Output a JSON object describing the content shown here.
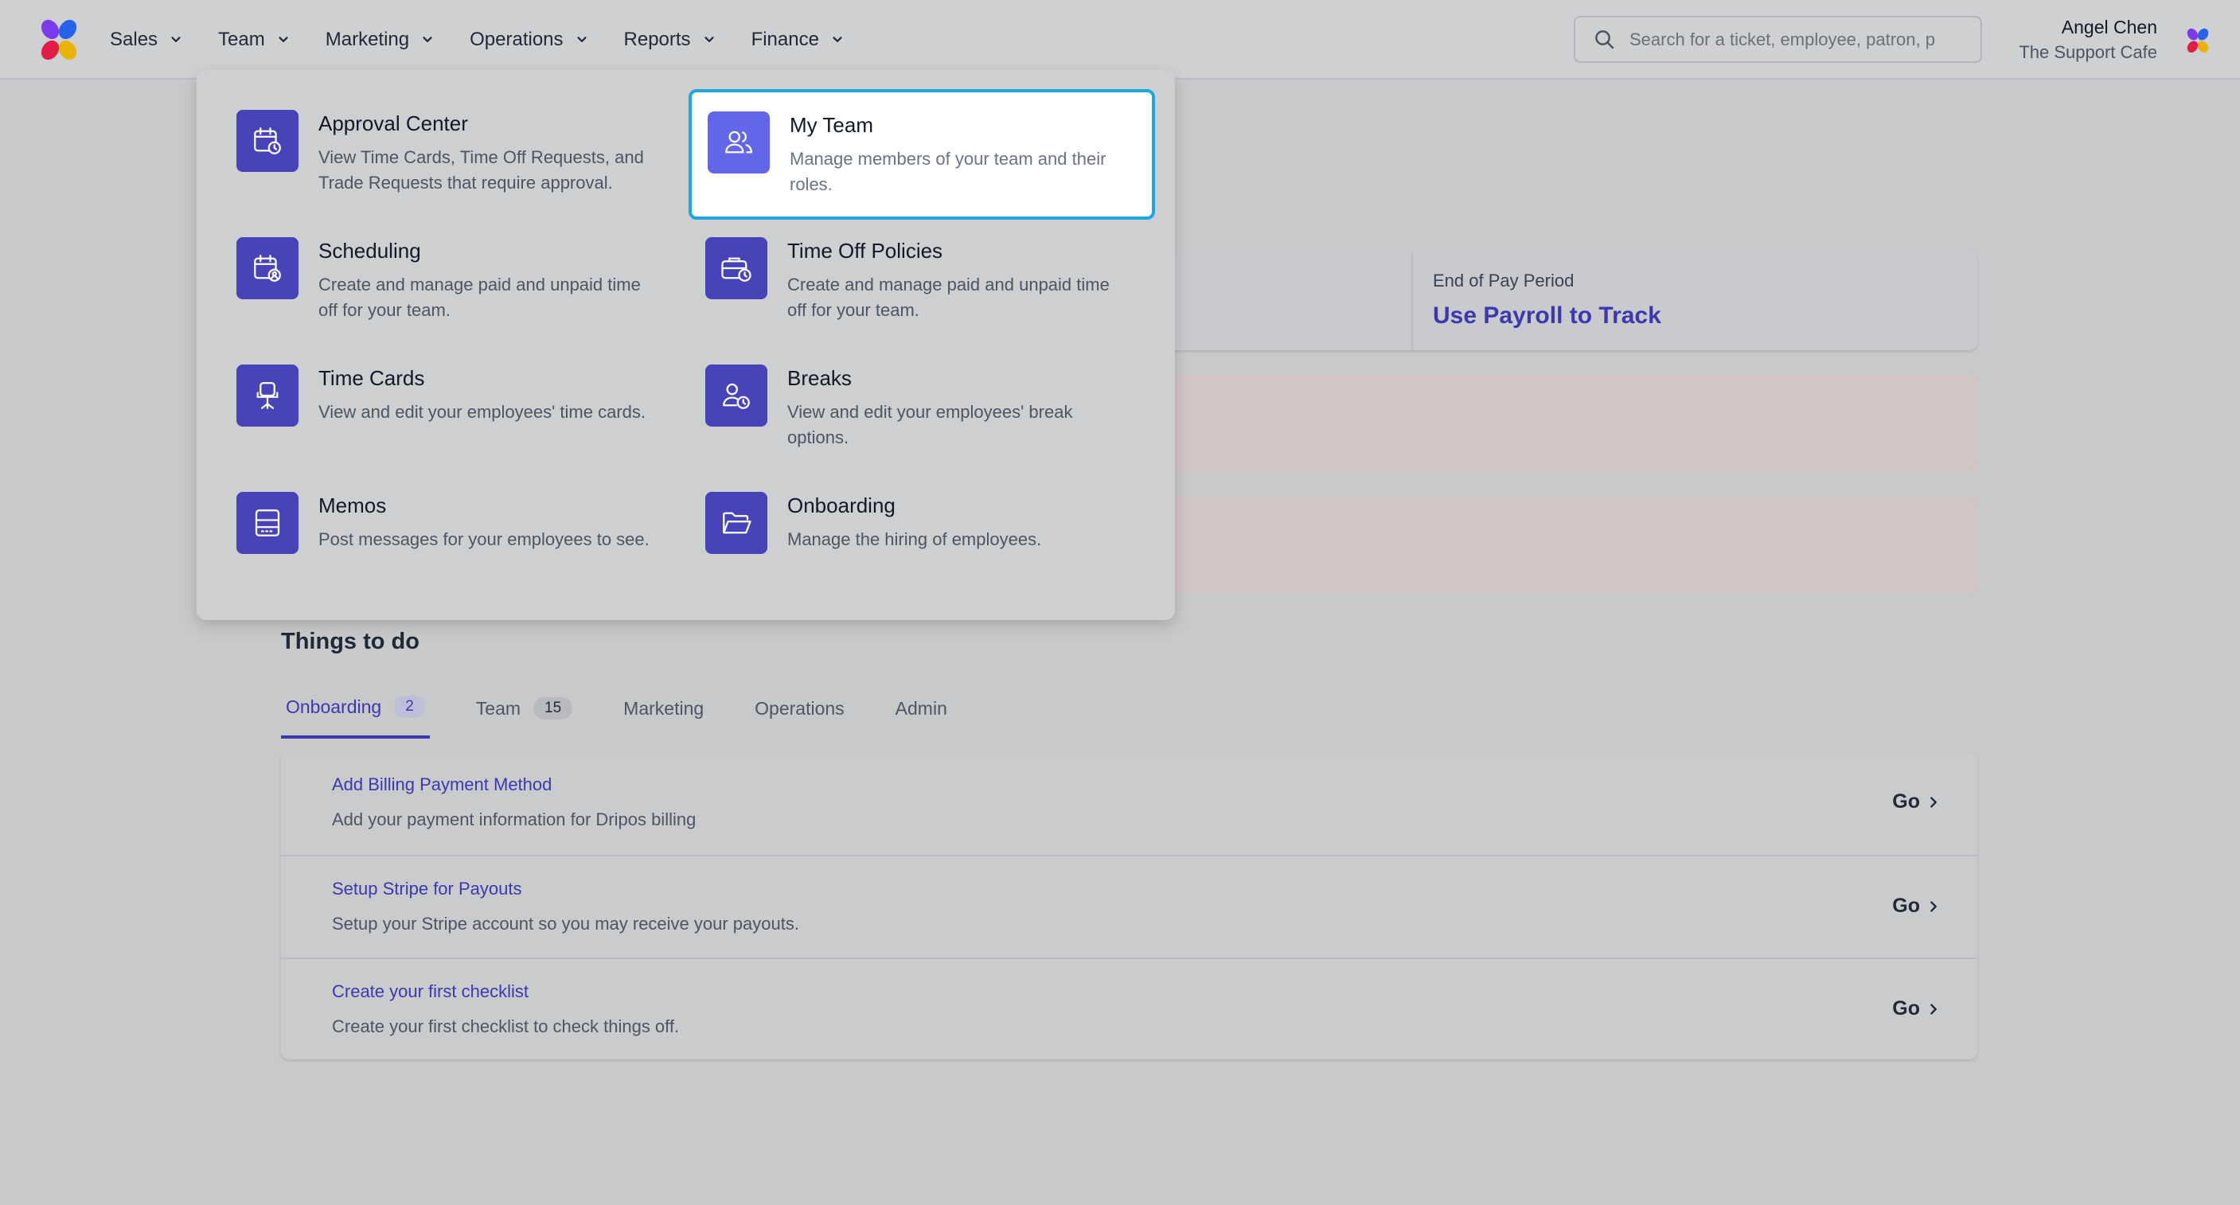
{
  "nav": {
    "items": [
      {
        "label": "Sales"
      },
      {
        "label": "Team"
      },
      {
        "label": "Marketing"
      },
      {
        "label": "Operations"
      },
      {
        "label": "Reports"
      },
      {
        "label": "Finance"
      }
    ]
  },
  "search": {
    "placeholder": "Search for a ticket, employee, patron, p"
  },
  "user": {
    "name": "Angel Chen",
    "org": "The Support Cafe"
  },
  "team_menu": {
    "items": [
      {
        "title": "Approval Center",
        "desc": "View Time Cards, Time Off Requests, and Trade Requests that require approval.",
        "icon": "calendar-clock-icon"
      },
      {
        "title": "My Team",
        "desc": "Manage members of your team and their roles.",
        "icon": "users-icon",
        "highlighted": true
      },
      {
        "title": "Scheduling",
        "desc": "Create and manage paid and unpaid time off for your team.",
        "icon": "calendar-user-icon"
      },
      {
        "title": "Time Off Policies",
        "desc": "Create and manage paid and unpaid time off for your team.",
        "icon": "briefcase-clock-icon"
      },
      {
        "title": "Time Cards",
        "desc": "View and edit your employees' time cards.",
        "icon": "office-chair-icon"
      },
      {
        "title": "Breaks",
        "desc": "View and edit your employees' break options.",
        "icon": "user-clock-icon"
      },
      {
        "title": "Memos",
        "desc": "Post messages for your employees to see.",
        "icon": "inbox-icon"
      },
      {
        "title": "Onboarding",
        "desc": "Manage the hiring of employees.",
        "icon": "folder-open-icon"
      }
    ]
  },
  "stats": {
    "label": "End of Pay Period",
    "value": "Use Payroll to Track"
  },
  "todo": {
    "title": "Things to do",
    "tabs": [
      {
        "label": "Onboarding",
        "count": "2",
        "active": true
      },
      {
        "label": "Team",
        "count": "15"
      },
      {
        "label": "Marketing"
      },
      {
        "label": "Operations"
      },
      {
        "label": "Admin"
      }
    ],
    "rows": [
      {
        "title": "Add Billing Payment Method",
        "desc": "Add your payment information for Dripos billing",
        "action": "Go"
      },
      {
        "title": "Setup Stripe for Payouts",
        "desc": "Setup your Stripe account so you may receive your payouts.",
        "action": "Go"
      },
      {
        "title": "Create your first checklist",
        "desc": "Create your first checklist to check things off.",
        "action": "Go"
      }
    ]
  },
  "colors": {
    "accent": "#3b38b0",
    "icon_bg": "#4743b9",
    "highlight_border": "#1ea7df"
  }
}
